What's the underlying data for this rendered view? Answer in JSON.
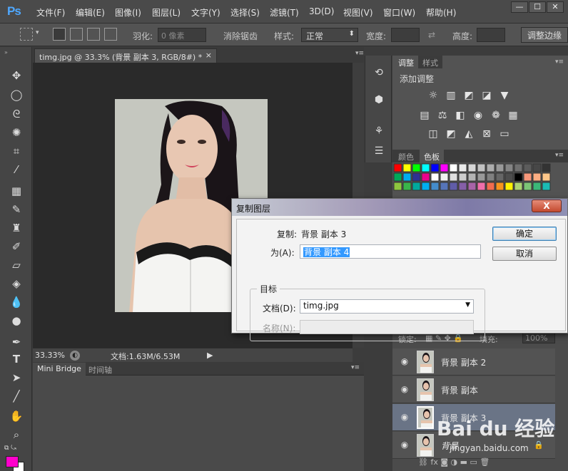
{
  "app": {
    "logo": "Ps"
  },
  "menu": [
    "文件(F)",
    "编辑(E)",
    "图像(I)",
    "图层(L)",
    "文字(Y)",
    "选择(S)",
    "滤镜(T)",
    "3D(D)",
    "视图(V)",
    "窗口(W)",
    "帮助(H)"
  ],
  "window_controls": {
    "minimize": "—",
    "restore": "☐",
    "close": "✕"
  },
  "options_bar": {
    "feather_label": "羽化:",
    "feather_value": "0 像素",
    "antialias_label": "消除锯齿",
    "style_label": "样式:",
    "style_value": "正常",
    "width_label": "宽度:",
    "height_label": "高度:",
    "refine_edge": "调整边缘"
  },
  "document": {
    "tab_title": "timg.jpg @ 33.3% (背景 副本 3, RGB/8#) *",
    "tab_close": "×",
    "zoom": "33.33%",
    "doc_size": "文档:1.63M/6.53M"
  },
  "bottom_tabs": {
    "mini_bridge": "Mini Bridge",
    "timeline": "时间轴"
  },
  "adjustments_panel": {
    "tab_adjust": "调整",
    "tab_styles": "样式",
    "title": "添加调整"
  },
  "swatches_panel": {
    "tab_color": "颜色",
    "tab_swatches": "色板"
  },
  "layers_panel": {
    "lock_label": "锁定:",
    "fill_label": "填充:",
    "fill_value": "100%",
    "layers": [
      {
        "name": "背景 副本 2",
        "selected": false
      },
      {
        "name": "背景 副本",
        "selected": false
      },
      {
        "name": "背景 副本 3",
        "selected": true
      },
      {
        "name": "背景",
        "selected": false
      }
    ]
  },
  "dialog": {
    "title": "复制图层",
    "close": "X",
    "copy_label": "复制:",
    "copy_value": "背景 副本 3",
    "as_label": "为(A):",
    "as_value": "背景 副本 4",
    "target_legend": "目标",
    "document_label": "文档(D):",
    "document_value": "timg.jpg",
    "name_label": "名称(N):",
    "name_value": "",
    "ok_button": "确定",
    "cancel_button": "取消"
  },
  "watermark": {
    "text": "Bai du 经验",
    "url": "jingyan.baidu.com"
  },
  "colors": {
    "foreground": "#ff00cc",
    "background": "#ffffff",
    "selection": "#3399ff"
  }
}
